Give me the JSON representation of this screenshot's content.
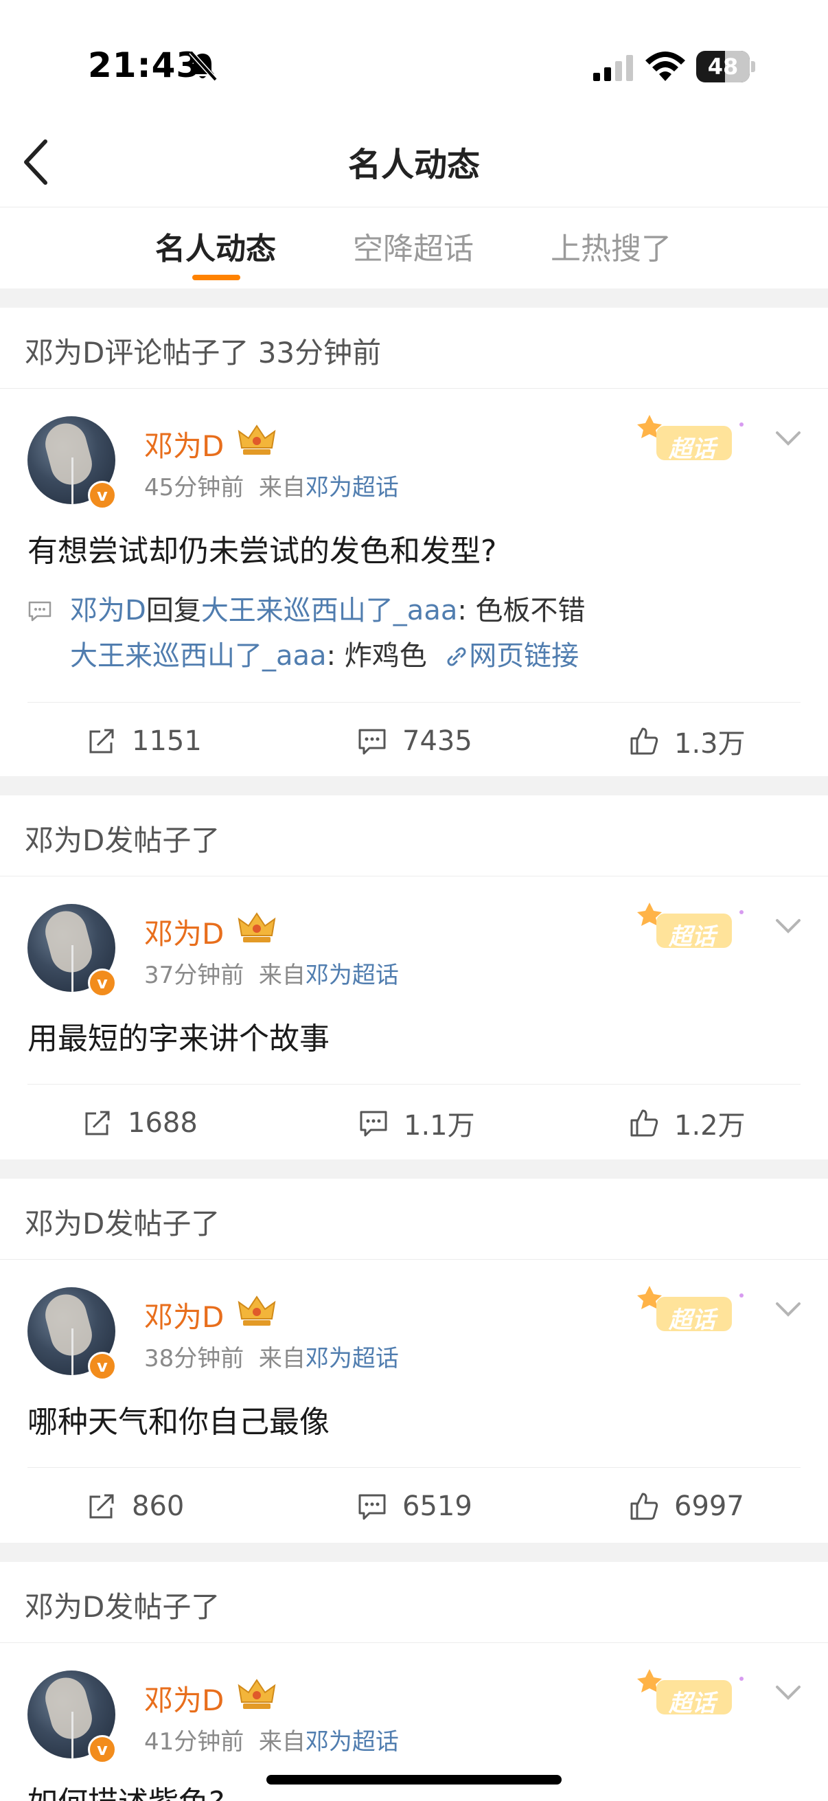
{
  "status_bar": {
    "time": "21:43",
    "battery": "48"
  },
  "nav": {
    "title": "名人动态"
  },
  "tabs": [
    {
      "label": "名人动态",
      "active": true
    },
    {
      "label": "空降超话",
      "active": false
    },
    {
      "label": "上热搜了",
      "active": false
    }
  ],
  "colors": {
    "accent": "#ff8200",
    "author": "#e86e1c",
    "link": "#507daf"
  },
  "cards": [
    {
      "header": "邓为D评论帖子了 33分钟前",
      "author": "邓为D",
      "time": "45分钟前",
      "from_label": "来自",
      "source": "邓为超话",
      "tag": "超话",
      "text": "有想尝试却仍未尝试的发色和发型?",
      "comment": {
        "l1_user": "邓为D",
        "l1_reply": "回复",
        "l1_target": "大王来巡西山了_aaa",
        "l1_text": ": 色板不错",
        "l2_user": "大王来巡西山了_aaa",
        "l2_text": ": 炸鸡色",
        "l2_link": "网页链接"
      },
      "reposts": "1151",
      "comments": "7435",
      "likes": "1.3万"
    },
    {
      "header": "邓为D发帖子了",
      "author": "邓为D",
      "time": "37分钟前",
      "from_label": "来自",
      "source": "邓为超话",
      "tag": "超话",
      "text": "用最短的字来讲个故事",
      "reposts": "1688",
      "comments": "1.1万",
      "likes": "1.2万"
    },
    {
      "header": "邓为D发帖子了",
      "author": "邓为D",
      "time": "38分钟前",
      "from_label": "来自",
      "source": "邓为超话",
      "tag": "超话",
      "text": "哪种天气和你自己最像",
      "reposts": "860",
      "comments": "6519",
      "likes": "6997"
    },
    {
      "header": "邓为D发帖子了",
      "author": "邓为D",
      "time": "41分钟前",
      "from_label": "来自",
      "source": "邓为超话",
      "tag": "超话",
      "text": "如何描述紫色?"
    }
  ]
}
